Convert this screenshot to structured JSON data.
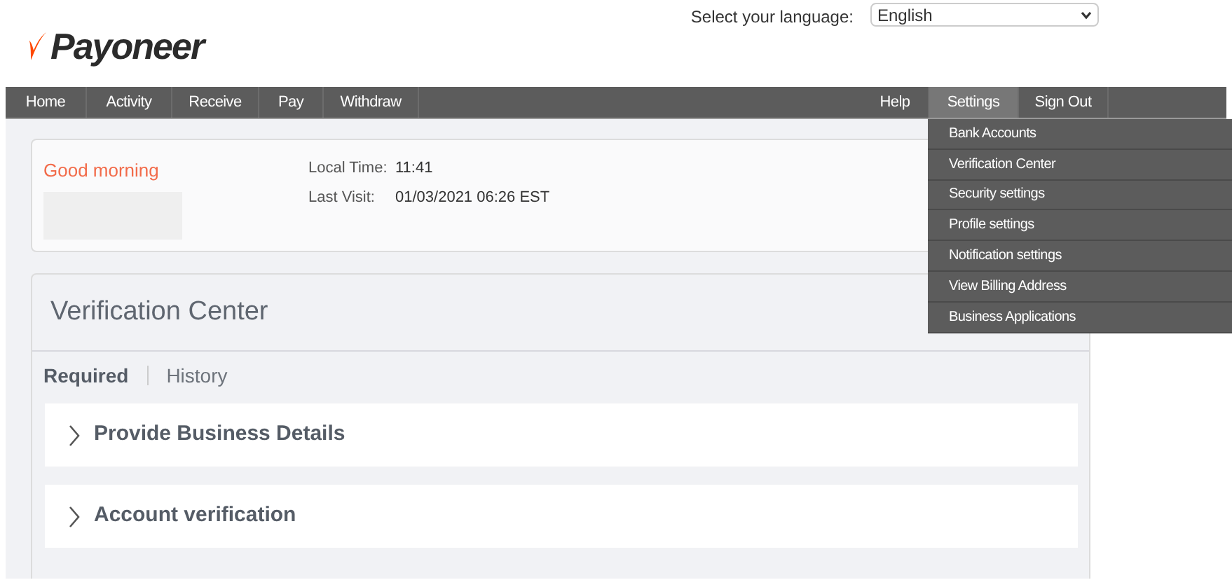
{
  "logo": {
    "text": "Payoneer"
  },
  "language": {
    "label": "Select your language:",
    "value": "English"
  },
  "nav_left": [
    {
      "label": "Home",
      "selected": false
    },
    {
      "label": "Activity",
      "selected": false
    },
    {
      "label": "Receive",
      "selected": false
    },
    {
      "label": "Pay",
      "selected": false
    },
    {
      "label": "Withdraw",
      "selected": false
    }
  ],
  "nav_right": [
    {
      "label": "Help",
      "selected": false
    },
    {
      "label": "Settings",
      "selected": true
    },
    {
      "label": "Sign Out",
      "selected": false
    }
  ],
  "settings_menu": {
    "expanded": true,
    "items": [
      "Bank Accounts",
      "Verification Center",
      "Security settings",
      "Profile settings",
      "Notification settings",
      "View Billing Address",
      "Business Applications"
    ]
  },
  "greeting": {
    "text": "Good morning",
    "local_time_label": "Local Time:",
    "local_time": "11:41",
    "last_visit_label": "Last Visit:",
    "last_visit": "01/03/2021 06:26 EST"
  },
  "verification": {
    "title": "Verification Center",
    "tabs": [
      {
        "label": "Required",
        "selected": true
      },
      {
        "label": "History",
        "selected": false
      }
    ],
    "sections": [
      {
        "title": "Provide Business Details",
        "expanded": false
      },
      {
        "title": "Account verification",
        "expanded": false
      }
    ]
  }
}
